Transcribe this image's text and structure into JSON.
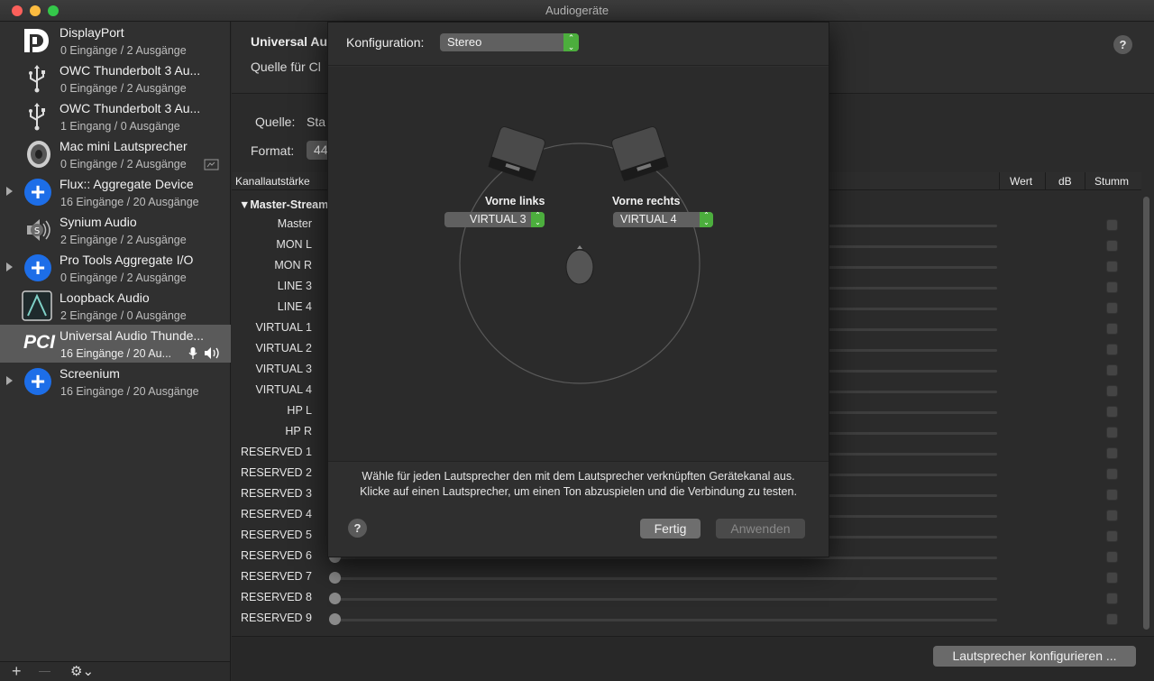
{
  "window": {
    "title": "Audiogeräte"
  },
  "sidebar": {
    "devices": [
      {
        "name": "DisplayPort",
        "sub": "0 Eingänge / 2 Ausgänge",
        "icon": "displayport-icon"
      },
      {
        "name": "OWC Thunderbolt 3 Au...",
        "sub": "0 Eingänge / 2 Ausgänge",
        "icon": "usb-icon"
      },
      {
        "name": "OWC Thunderbolt 3 Au...",
        "sub": "1 Eingang / 0 Ausgänge",
        "icon": "usb-icon"
      },
      {
        "name": "Mac mini Lautsprecher",
        "sub": "0 Eingänge / 2 Ausgänge",
        "icon": "speaker-icon"
      },
      {
        "name": "Flux:: Aggregate Device",
        "sub": "16 Eingänge / 20 Ausgänge",
        "icon": "aggregate-plus-icon"
      },
      {
        "name": "Synium Audio",
        "sub": "2 Eingänge / 2 Ausgänge",
        "icon": "synium-speaker-icon"
      },
      {
        "name": "Pro Tools Aggregate I/O",
        "sub": "0 Eingänge / 2 Ausgänge",
        "icon": "aggregate-plus-icon"
      },
      {
        "name": "Loopback Audio",
        "sub": "2 Eingänge / 0 Ausgänge",
        "icon": "loopback-icon"
      },
      {
        "name": "Universal Audio Thunde...",
        "sub": "16 Eingänge / 20 Au...",
        "icon": "pci-icon"
      },
      {
        "name": "Screenium",
        "sub": "16 Eingänge / 20 Ausgänge",
        "icon": "aggregate-plus-icon"
      }
    ],
    "pci_label": "PCI",
    "add_glyph": "+",
    "remove_glyph": "—",
    "gear_glyph": "⚙︎⌄"
  },
  "main": {
    "device_title": "Universal Au",
    "clock_label": "Quelle für Cl",
    "source_label": "Quelle:",
    "source_value": "Sta",
    "format_label": "Format:",
    "format_value": "44",
    "help": "?",
    "columns": {
      "volume": "Kanallautstärke",
      "value": "Wert",
      "db": "dB",
      "mute": "Stumm"
    },
    "stream_label": "▼Master-Stream",
    "channels": [
      "Master",
      "MON L",
      "MON R",
      "LINE 3",
      "LINE 4",
      "VIRTUAL 1",
      "VIRTUAL 2",
      "VIRTUAL 3",
      "VIRTUAL 4",
      "HP L",
      "HP R",
      "RESERVED 1",
      "RESERVED 2",
      "RESERVED 3",
      "RESERVED 4",
      "RESERVED 5",
      "RESERVED 6",
      "RESERVED 7",
      "RESERVED 8",
      "RESERVED 9"
    ],
    "configure_button": "Lautsprecher konfigurieren ..."
  },
  "sheet": {
    "config_label": "Konfiguration:",
    "config_value": "Stereo",
    "left_label": "Vorne links",
    "left_value": "VIRTUAL 3",
    "right_label": "Vorne rechts",
    "right_value": "VIRTUAL 4",
    "instructions_1": "Wähle für jeden Lautsprecher den mit dem Lautsprecher verknüpften Gerätekanal aus.",
    "instructions_2": "Klicke auf einen Lautsprecher, um einen Ton abzuspielen und die Verbindung zu testen.",
    "help": "?",
    "done_button": "Fertig",
    "apply_button": "Anwenden"
  }
}
